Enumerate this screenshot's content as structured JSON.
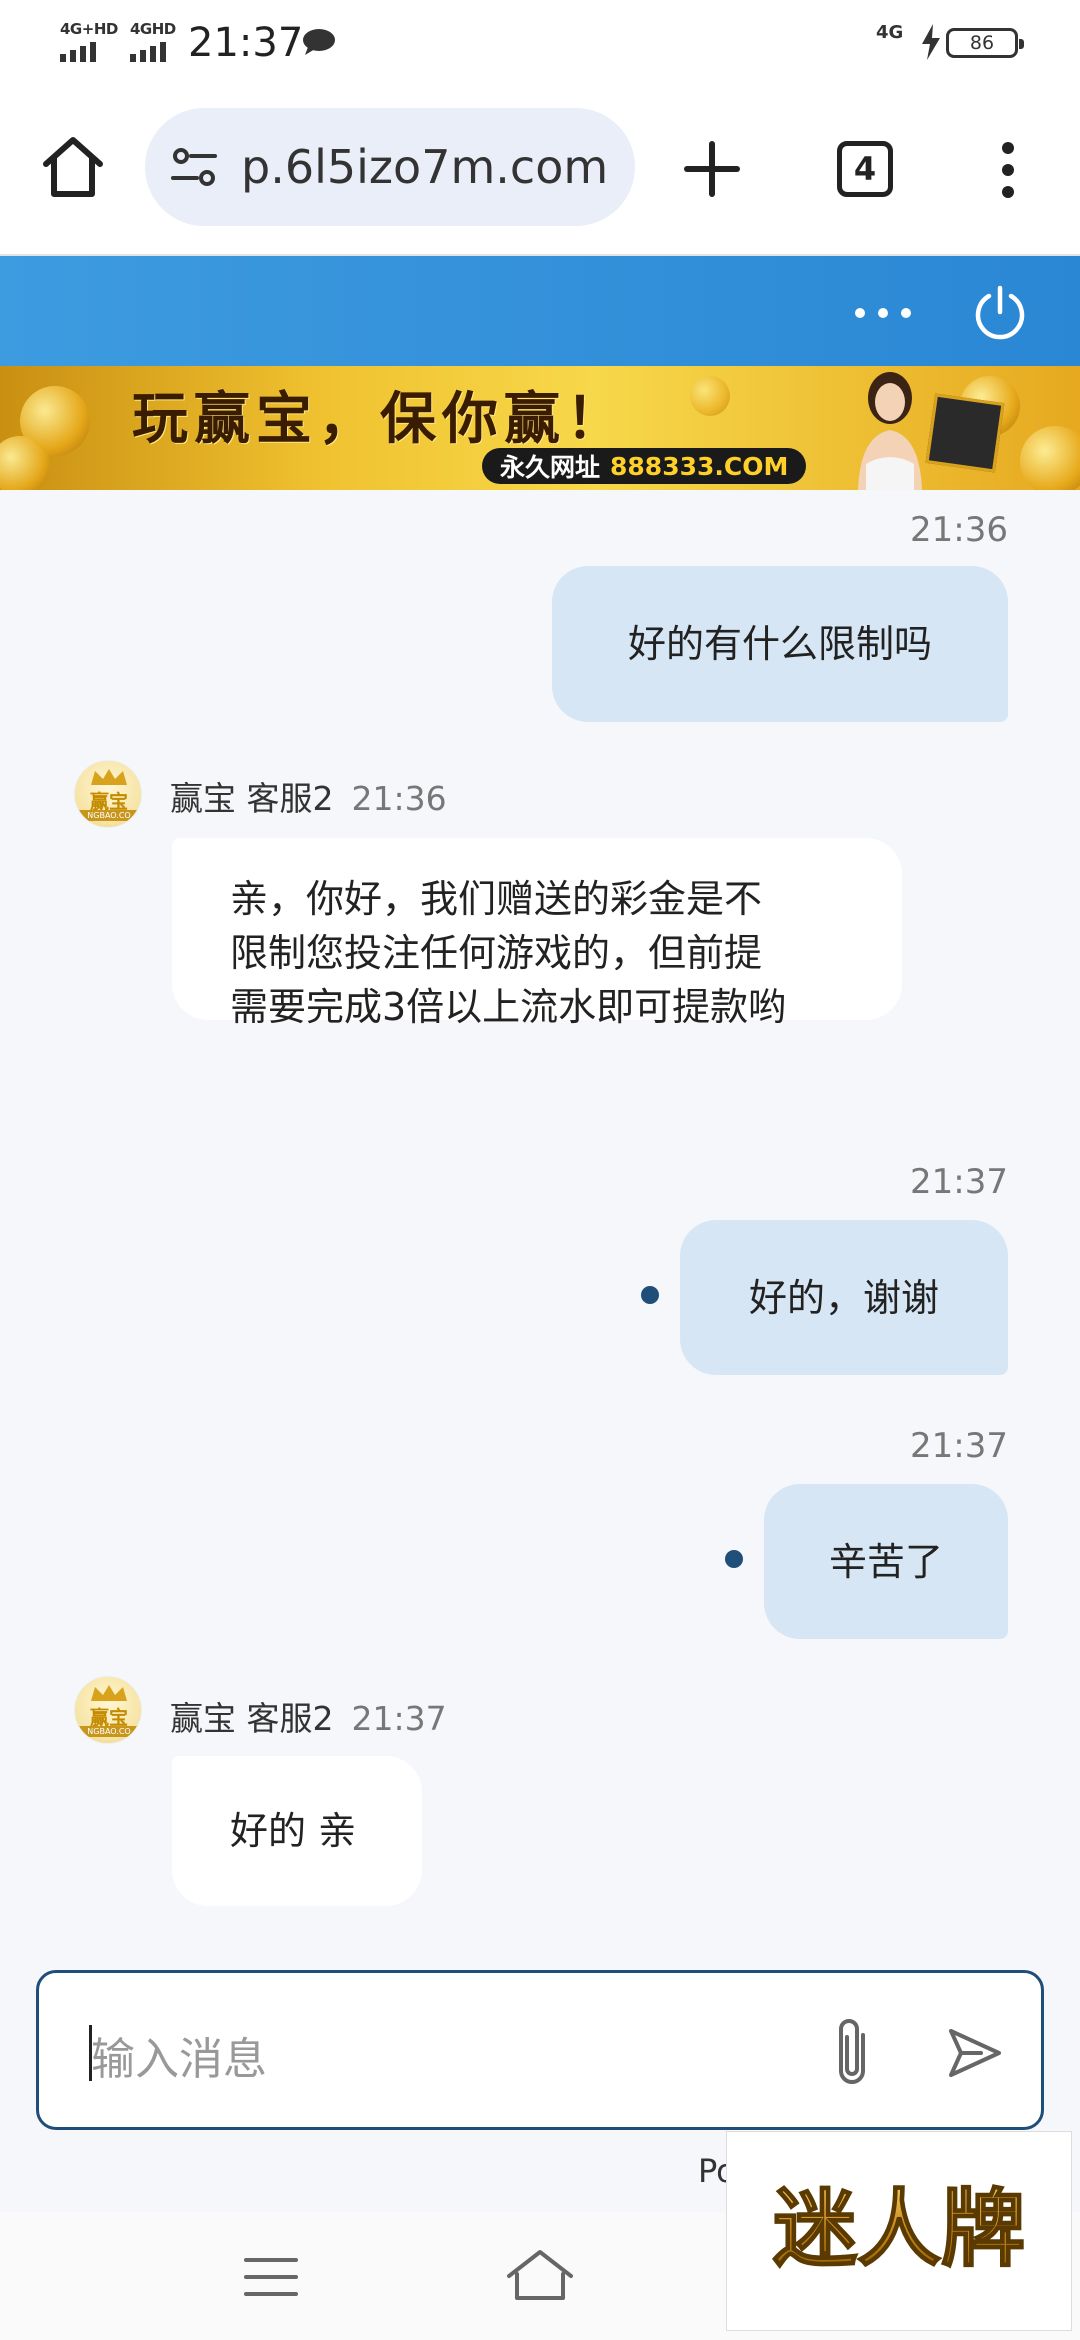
{
  "status_bar": {
    "signal1_label": "4G+HD",
    "signal2_label": "4GHD",
    "time": "21:37",
    "net_right": "4G",
    "battery": "86"
  },
  "browser": {
    "url": "p.6l5izo7m.com",
    "tab_count": "4",
    "icons": [
      "home-icon",
      "tune-icon",
      "plus-icon",
      "tab-switcher-icon",
      "more-vert-icon"
    ]
  },
  "chat_header": {
    "icons": [
      "more-horiz-icon",
      "power-icon"
    ]
  },
  "banner": {
    "slogan": "玩赢宝，保你赢！",
    "url_label": "永久网址",
    "url_domain": "888333.COM"
  },
  "messages": [
    {
      "from": "me",
      "time": "21:36",
      "text": "好的有什么限制吗"
    },
    {
      "from": "agent",
      "sender": "赢宝 客服2",
      "time": "21:36",
      "lines": [
        "亲，你好，我们赠送的彩金是不",
        "限制您投注任何游戏的，但前提",
        "需要完成3倍以上流水即可提款哟"
      ]
    },
    {
      "from": "me",
      "time": "21:37",
      "text": "好的，谢谢",
      "unread": true
    },
    {
      "from": "me",
      "time": "21:37",
      "text": "辛苦了",
      "unread": true
    },
    {
      "from": "agent",
      "sender": "赢宝 客服2",
      "time": "21:37",
      "text": "好的 亲"
    }
  ],
  "avatar": {
    "text": "赢宝",
    "band": "NGBAO.CO"
  },
  "input": {
    "placeholder": "输入消息"
  },
  "powered_text": "Po",
  "watermark_text": "迷人牌",
  "colors": {
    "header_blue": "#2a87d4",
    "my_bubble": "#d7e6f4",
    "accent": "#1f4e79"
  }
}
